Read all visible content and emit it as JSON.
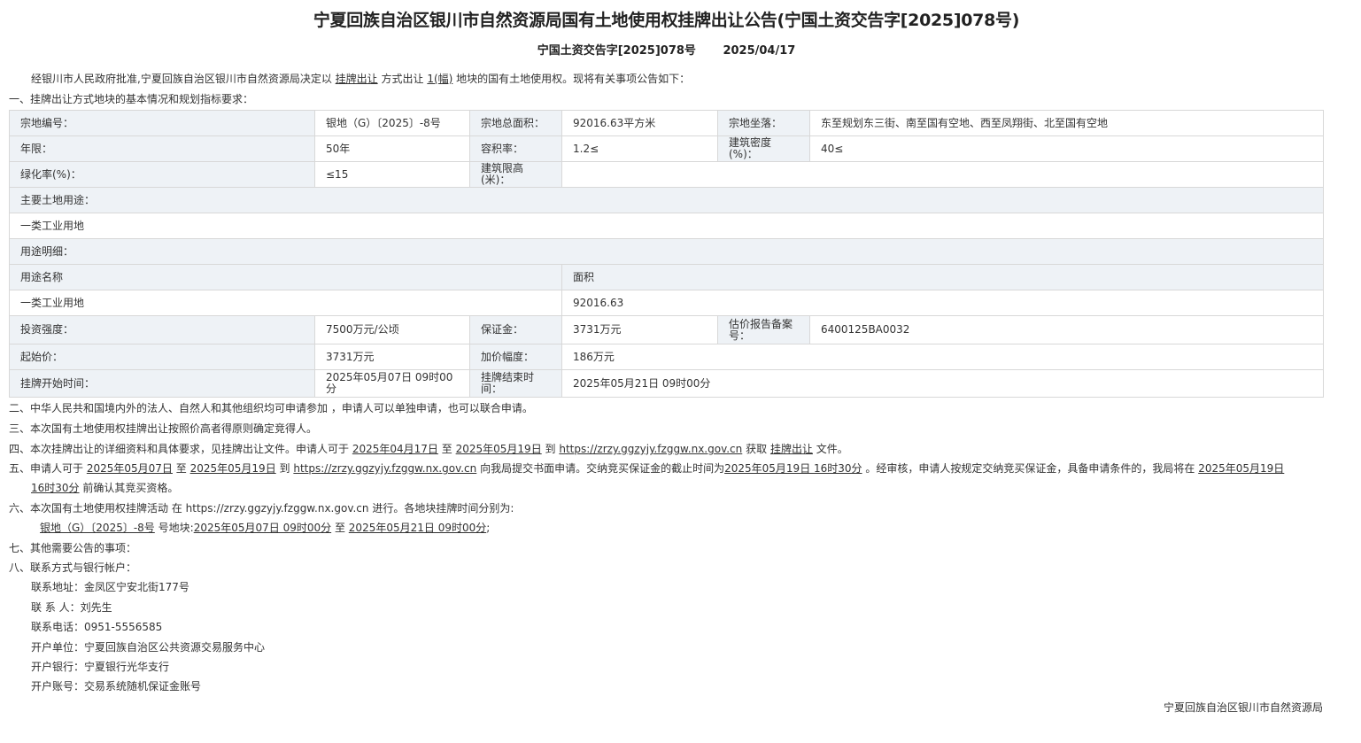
{
  "title": "宁夏回族自治区银川市自然资源局国有土地使用权挂牌出让公告(宁国土资交告字[2025]078号)",
  "subtitle": {
    "doc_no": "宁国土资交告字[2025]078号",
    "date": "2025/04/17"
  },
  "intro": {
    "a": "经银川市人民政府批准,宁夏回族自治区银川市自然资源局决定以",
    "method": "挂牌出让",
    "b": "方式出让",
    "count": "1(幅)",
    "c": "地块的国有土地使用权。现将有关事项公告如下："
  },
  "section1": "一、挂牌出让方式地块的基本情况和规划指标要求：",
  "table": {
    "parcel_no_label": "宗地编号：",
    "parcel_no": "银地（G）〔2025〕-8号",
    "area_label": "宗地总面积：",
    "area": "92016.63平方米",
    "location_label": "宗地坐落：",
    "location": "东至规划东三街、南至国有空地、西至凤翔街、北至国有空地",
    "term_label": "年限：",
    "term": "50年",
    "far_label": "容积率：",
    "far": "1.2≤",
    "density_label": "建筑密度(%)：",
    "density": "40≤",
    "green_label": "绿化率(%)：",
    "green": "≤15",
    "height_label": "建筑限高(米)：",
    "height": "",
    "main_use_label": "主要土地用途：",
    "main_use": "一类工业用地",
    "use_detail_label": "用途明细：",
    "use_name_header": "用途名称",
    "use_area_header": "面积",
    "use_name": "一类工业用地",
    "use_area": "92016.63",
    "invest_label": "投资强度：",
    "invest": "7500万元/公顷",
    "deposit_label": "保证金：",
    "deposit": "3731万元",
    "appraisal_label": "估价报告备案号：",
    "appraisal": "6400125BA0032",
    "start_price_label": "起始价：",
    "start_price": "3731万元",
    "increment_label": "加价幅度：",
    "increment": "186万元",
    "list_start_label": "挂牌开始时间：",
    "list_start": "2025年05月07日 09时00分",
    "list_end_label": "挂牌结束时间：",
    "list_end": "2025年05月21日 09时00分"
  },
  "item2": "二、中华人民共和国境内外的法人、自然人和其他组织均可申请参加 ，申请人可以单独申请，也可以联合申请。",
  "item3": "三、本次国有土地使用权挂牌出让按照价高者得原则确定竞得人。",
  "item4": {
    "a": "四、本次挂牌出让的详细资料和具体要求，见挂牌出让文件。申请人可于",
    "from": "2025年04月17日",
    "to_word": "至",
    "to": "2025年05月19日",
    "at_word": "到",
    "url": "https://zrzy.ggzyjy.fzggw.nx.gov.cn",
    "get_word": "获取",
    "method": "挂牌出让",
    "doc_word": "文件。"
  },
  "item5": {
    "a": "五、申请人可于",
    "from": "2025年05月07日",
    "to_word": "至",
    "to": "2025年05月19日",
    "at_word": "到",
    "url": "https://zrzy.ggzyjy.fzggw.nx.gov.cn",
    "b": "向我局提交书面申请。交纳竞买保证金的截止时间为",
    "deadline": "2025年05月19日 16时30分",
    "c": "。经审核，申请人按规定交纳竞买保证金，具备申请条件的，我局将在",
    "confirm_date": "2025年05月19日",
    "confirm_time": "16时30分",
    "d": "前确认其竞买资格。"
  },
  "item6": {
    "a": "六、本次国有土地使用权挂牌活动 在 https://zrzy.ggzyjy.fzggw.nx.gov.cn 进行。各地块挂牌时间分别为:",
    "parcel": "银地（G）〔2025〕-8号",
    "b": "号地块:",
    "start": "2025年05月07日 09时00分",
    "to_word": "至",
    "end": "2025年05月21日 09时00分",
    "end_punct": ";"
  },
  "item7": "七、其他需要公告的事项：",
  "item8": "八、联系方式与银行帐户：",
  "contact": {
    "address": "联系地址：金凤区宁安北街177号",
    "person": "联 系 人：刘先生",
    "phone": "联系电话：0951-5556585",
    "account_unit": "开户单位：宁夏回族自治区公共资源交易服务中心",
    "bank": "开户银行：宁夏银行光华支行",
    "account_no": "开户账号：交易系统随机保证金账号"
  },
  "footer": "宁夏回族自治区银川市自然资源局"
}
